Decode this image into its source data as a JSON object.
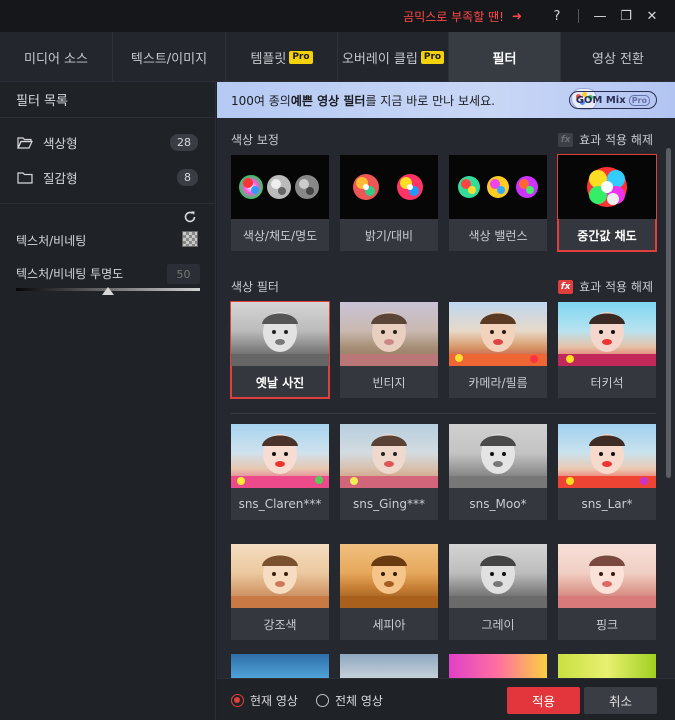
{
  "titlebar": {
    "promo_text": "곰믹스로 부족할 땐!",
    "promo_arrow": "➜",
    "help_label": "?",
    "minimize_label": "—",
    "restore_label": "❐",
    "close_label": "✕"
  },
  "tabs": [
    {
      "label": "미디어 소스",
      "pro": false
    },
    {
      "label": "텍스트/이미지",
      "pro": false
    },
    {
      "label": "템플릿",
      "pro": true
    },
    {
      "label": "오버레이 클립",
      "pro": true
    },
    {
      "label": "필터",
      "pro": false,
      "active": true
    },
    {
      "label": "영상 전환",
      "pro": false
    }
  ],
  "pro_badge": "Pro",
  "sidebar": {
    "title": "필터 목록",
    "categories": [
      {
        "label": "색상형",
        "count": "28"
      },
      {
        "label": "질감형",
        "count": "8"
      }
    ],
    "texture_label": "텍스처/비네팅",
    "texture_opacity_label": "텍스처/비네팅 투명도",
    "texture_opacity_value": "50",
    "texture_opacity_slider": 0.5
  },
  "banner": {
    "text_prefix": "100여 종의 ",
    "text_bold": "예쁜 영상 필터",
    "text_suffix": "를 지금 바로 만나 보세요.",
    "brand": "GOM Mix",
    "brand_pro": "Pro"
  },
  "color_correction": {
    "title": "색상 보정",
    "remove_label": "효과 적용 해제",
    "items": [
      "색상/채도/명도",
      "밝기/대비",
      "색상 밸런스",
      "중간값 채도"
    ]
  },
  "color_filter": {
    "title": "색상 필터",
    "remove_label": "효과 적용 해제",
    "rows": [
      [
        "옛날 사진",
        "빈티지",
        "카메라/필름",
        "터키석"
      ],
      [
        "sns_Claren***",
        "sns_Ging***",
        "sns_Moo*",
        "sns_Lar*"
      ],
      [
        "강조색",
        "세피아",
        "그레이",
        "핑크"
      ]
    ]
  },
  "fx_label": "fx",
  "bottom": {
    "current_video": "현재 영상",
    "all_video": "전체 영상",
    "apply": "적용",
    "cancel": "취소"
  },
  "colors": {
    "accent": "#e2353c",
    "background": "#1d2026",
    "banner": "#c3d3f5",
    "pro_badge": "#f4d20a"
  }
}
